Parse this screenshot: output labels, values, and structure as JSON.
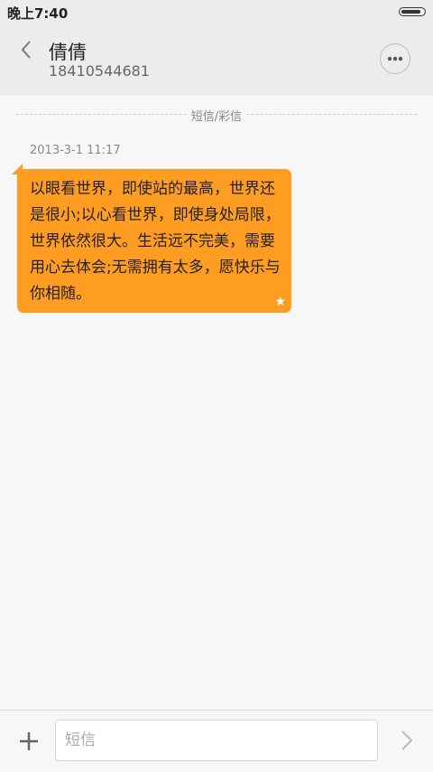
{
  "status_bar": {
    "time": "晚上7:40",
    "battery_level": 0.9
  },
  "header": {
    "contact_name": "倩倩",
    "phone_number": "18410544681",
    "back_icon": "chevron-left-icon",
    "more_icon": "more-dots-icon"
  },
  "thread": {
    "divider_label": "短信/彩信",
    "messages": [
      {
        "time": "2013-3-1 11:17",
        "text": "以眼看世界，即使站的最高，世界还是很小;以心看世界，即使身处局限，世界依然很大。生活远不完美，需要用心去体会;无需拥有太多，愿快乐与你相随。",
        "starred": true,
        "bubble_color": "#ff9c22"
      }
    ]
  },
  "composer": {
    "placeholder": "短信",
    "add_icon": "plus-icon",
    "send_icon": "chevron-right-icon"
  }
}
